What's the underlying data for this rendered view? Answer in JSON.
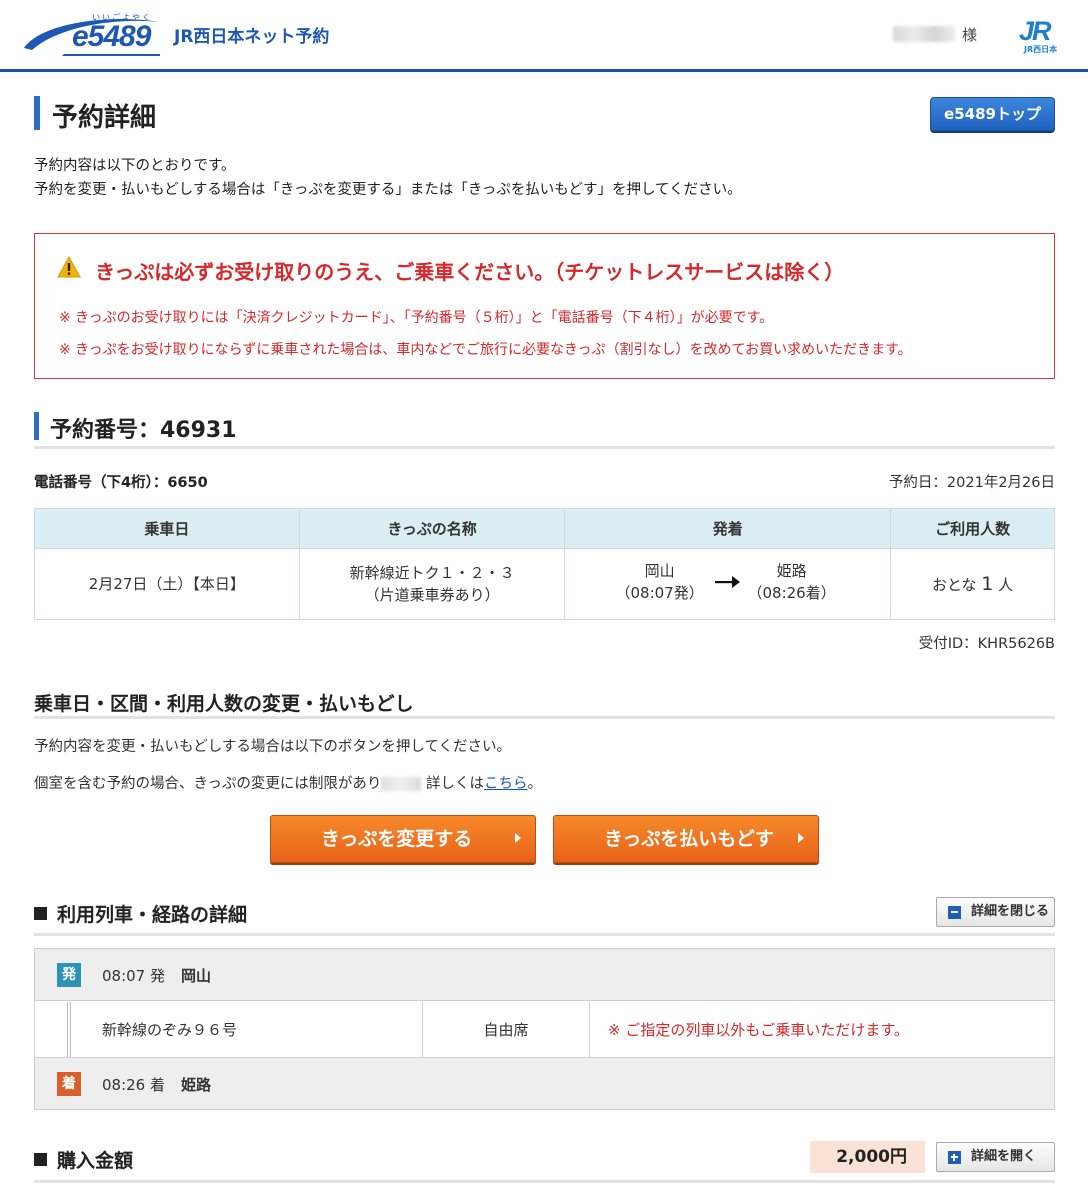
{
  "header": {
    "logo_text": "e5489",
    "logo_ruby": "いいごよやく",
    "site_name": "JR西日本ネット予約",
    "user_suffix": "様",
    "jr_logo": "JR",
    "jr_sub": "JR西日本"
  },
  "page": {
    "title": "予約詳細",
    "top_button": "e5489トップ",
    "intro_line1": "予約内容は以下のとおりです。",
    "intro_line2": "予約を変更・払いもどしする場合は「きっぷを変更する」または「きっぷを払いもどす」を押してください。"
  },
  "alert": {
    "icon": "warning-icon",
    "title": "きっぷは必ずお受け取りのうえ、ご乗車ください。（チケットレスサービスは除く）",
    "note1": "※ きっぷのお受け取りには「決済クレジットカード」、「予約番号（５桁）」と「電話番号（下４桁）」が必要です。",
    "note2": "※ きっぷをお受け取りにならずに乗車された場合は、車内などでご旅行に必要なきっぷ（割引なし）を改めてお買い求めいただきます。",
    "color": "#d6282b"
  },
  "reservation": {
    "number_heading": "予約番号：46931",
    "phone": "電話番号（下4桁）：6650",
    "reserved_date": "予約日：2021年2月26日",
    "receipt_id": "受付ID：KHR5626B"
  },
  "ticket_table": {
    "headers": [
      "乗車日",
      "きっぷの名称",
      "発着",
      "ご利用人数"
    ],
    "date": "2月27日（土）【本日】",
    "name_line1": "新幹線近トク１・２・３",
    "name_line2": "（片道乗車券あり）",
    "from_station": "岡山",
    "from_time": "（08:07発）",
    "to_station": "姫路",
    "to_time": "（08:26着）",
    "people_prefix": "おとな",
    "people_count": "1",
    "people_suffix": "人"
  },
  "change": {
    "title": "乗車日・区間・利用人数の変更・払いもどし",
    "text1": "予約内容を変更・払いもどしする場合は以下のボタンを押してください。",
    "text2_pre": "個室を含む予約の場合、きっぷの変更には制限があり",
    "text2_mid": "詳しくは",
    "text2_link": "こちら",
    "text2_end": "。",
    "change_button": "きっぷを変更する",
    "refund_button": "きっぷを払いもどす"
  },
  "route": {
    "title": "利用列車・経路の詳細",
    "toggle_button": "詳細を閉じる",
    "dep_badge": "発",
    "dep_time": "08:07 発",
    "dep_station": "岡山",
    "train": "新幹線のぞみ９６号",
    "seat": "自由席",
    "note": "※ ご指定の列車以外もご乗車いただけます。",
    "arr_badge": "着",
    "arr_time": "08:26 着",
    "arr_station": "姫路"
  },
  "purchase": {
    "title": "購入金額",
    "amount": "2,000円",
    "toggle_button": "詳細を開く"
  }
}
